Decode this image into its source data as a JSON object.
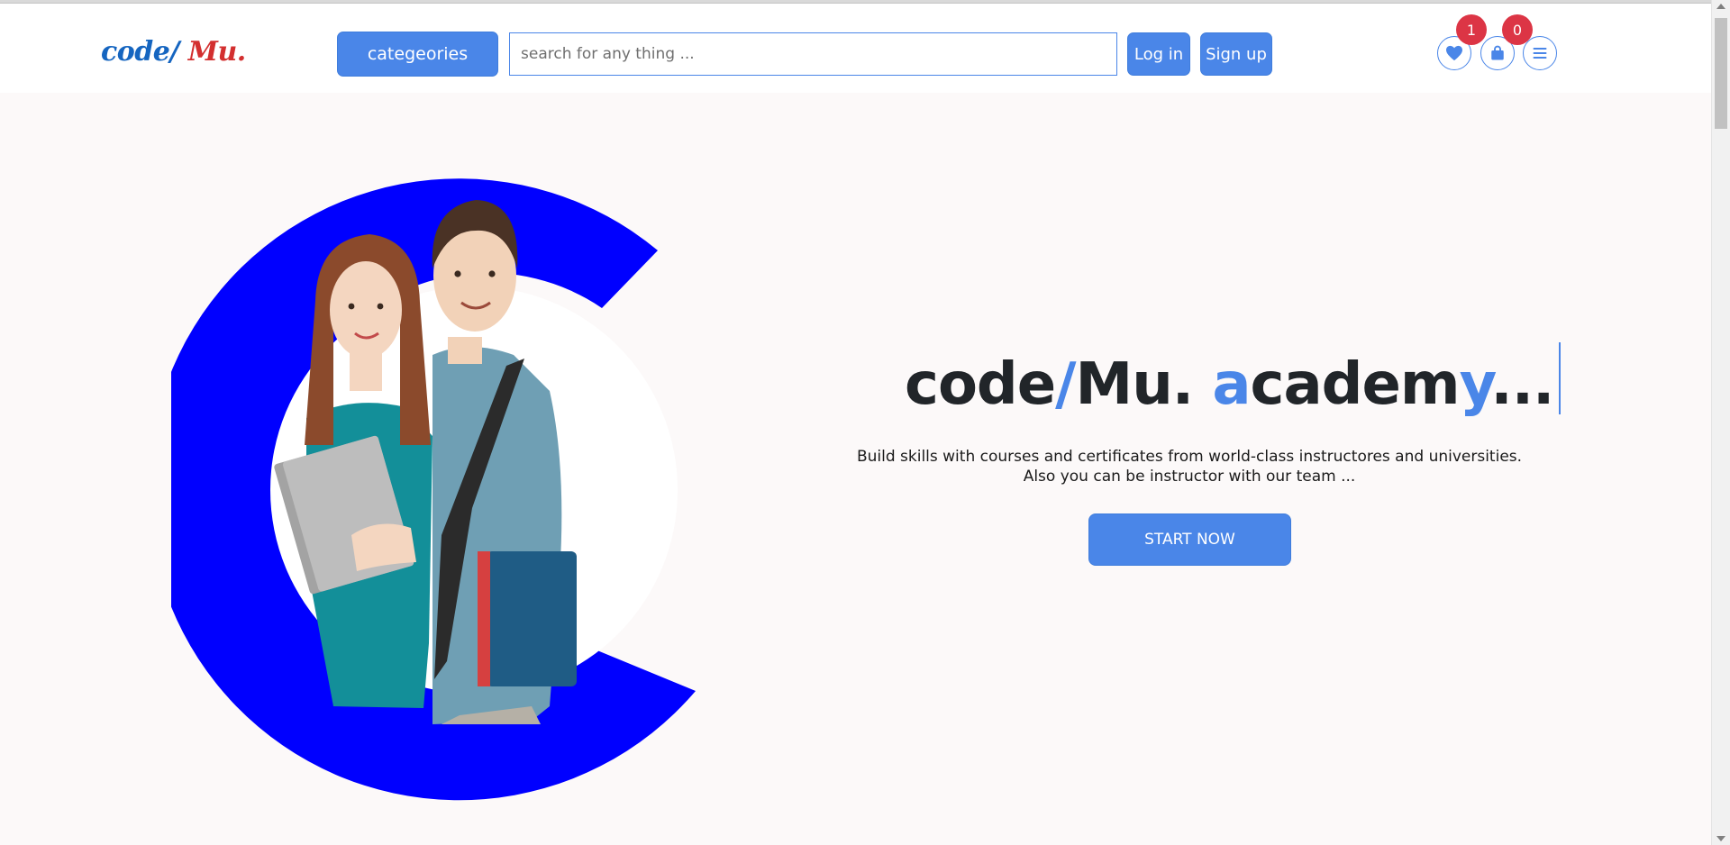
{
  "navbar": {
    "logo_part1": "code/",
    "logo_part2": " Mu.",
    "categories_label": "categeories",
    "search_placeholder": "search for any thing ...",
    "login_label": "Log in",
    "signup_label": "Sign up",
    "icons": [
      "heart-icon",
      "bag-icon",
      "menu-icon"
    ],
    "wishlist_count": "1",
    "cart_count": "0"
  },
  "hero": {
    "headline_part1": "code",
    "headline_slash": "/",
    "headline_part2": "Mu. ",
    "headline_a": "a",
    "headline_mid": "cadem",
    "headline_y": "y",
    "headline_end": "...",
    "subtitle_line1": "Build skills with courses and certificates from world-class instructores and universities.",
    "subtitle_line2": "Also you can be instructor with our team ...",
    "cta_label": "START NOW"
  },
  "colors": {
    "accent": "#4a86e8",
    "badge": "#dc3545",
    "logo_blue": "#1565c0",
    "logo_red": "#d32f2f",
    "hero_ring": "#0000ff",
    "hero_bg": "#fcf9f9"
  }
}
